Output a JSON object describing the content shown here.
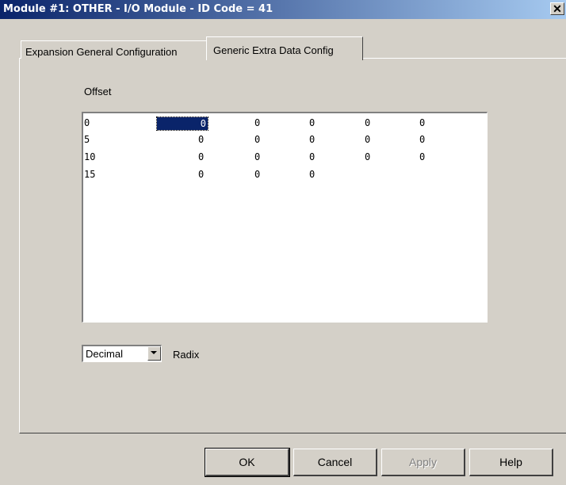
{
  "window": {
    "title": "Module #1: OTHER - I/O Module - ID Code = 41",
    "close_glyph": "✕"
  },
  "tabs": [
    {
      "label": "Expansion General Configuration",
      "active": false
    },
    {
      "label": "Generic Extra Data Config",
      "active": true
    }
  ],
  "offset_label": "Offset",
  "table": {
    "rows": [
      {
        "offset": "0",
        "values": [
          "0",
          "0",
          "0",
          "0",
          "0"
        ],
        "selected_col": 0
      },
      {
        "offset": "5",
        "values": [
          "0",
          "0",
          "0",
          "0",
          "0"
        ]
      },
      {
        "offset": "10",
        "values": [
          "0",
          "0",
          "0",
          "0",
          "0"
        ]
      },
      {
        "offset": "15",
        "values": [
          "0",
          "0",
          "0"
        ]
      }
    ]
  },
  "radix": {
    "selected": "Decimal",
    "label": "Radix"
  },
  "buttons": {
    "ok": "OK",
    "cancel": "Cancel",
    "apply": "Apply",
    "help": "Help"
  },
  "colors": {
    "titlebar_start": "#0a246a",
    "titlebar_end": "#a6caf0",
    "face": "#d4d0c8",
    "selection": "#0a246a"
  }
}
